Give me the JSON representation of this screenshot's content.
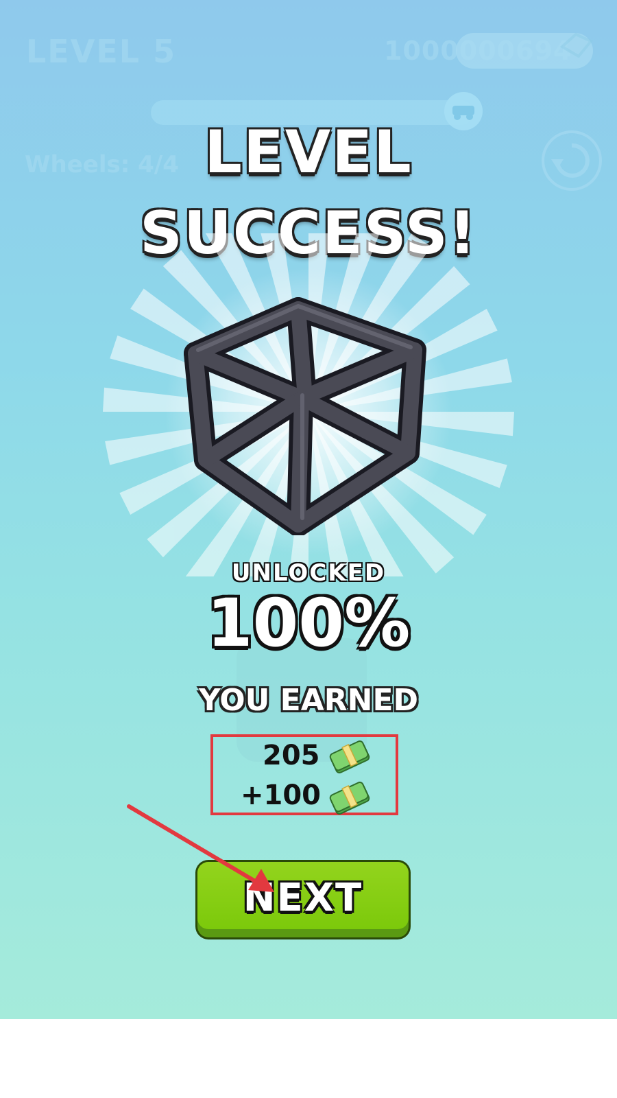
{
  "hud": {
    "level_label": "LEVEL 5",
    "coins": "1000000694",
    "wheels_label": "Wheels: 4/4"
  },
  "result": {
    "title_line1": "LEVEL",
    "title_line2": "SUCCESS!",
    "unlocked_label": "UNLOCKED",
    "unlocked_percent": "100%",
    "earned_label": "YOU EARNED",
    "reward_base": "205",
    "reward_bonus": "+100"
  },
  "buttons": {
    "next_label": "NEXT"
  },
  "colors": {
    "highlight_box": "#e2393f",
    "arrow": "#e2393f",
    "next_button": "#7cc90b"
  },
  "icons": {
    "reward_item": "wireframe-cube-icon",
    "currency": "cash-icon",
    "restart": "restart-icon",
    "gem": "gem-icon"
  }
}
